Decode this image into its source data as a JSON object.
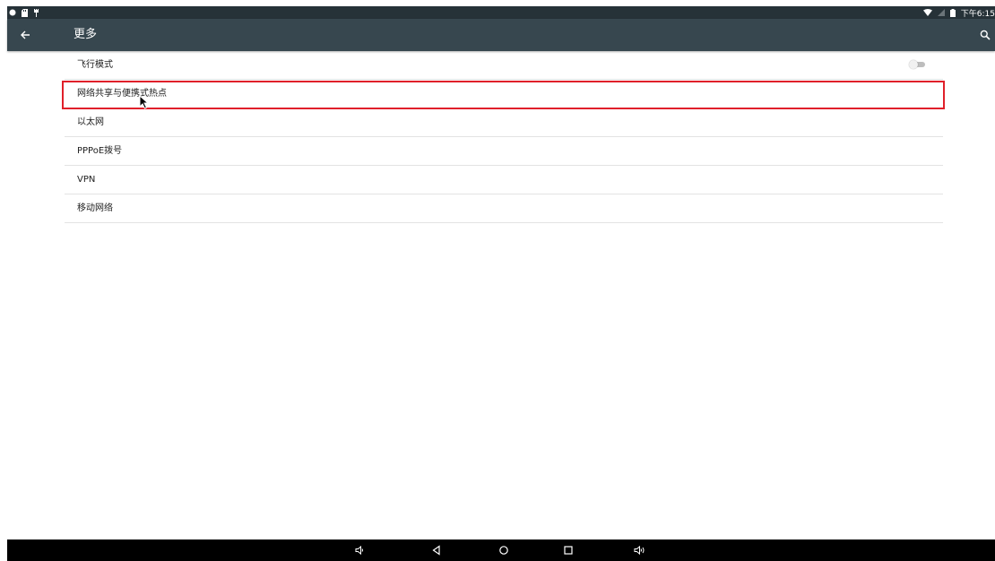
{
  "status_bar": {
    "time": "下午6:15",
    "left_icons": [
      "circle-notification-icon",
      "sd-card-icon",
      "usb-icon"
    ],
    "right_icons": [
      "wifi-icon",
      "signal-icon",
      "battery-icon"
    ]
  },
  "app_bar": {
    "title": "更多",
    "back_icon": "arrow-back-icon",
    "search_icon": "search-icon"
  },
  "settings": {
    "items": [
      {
        "label": "飞行模式",
        "toggle": false
      },
      {
        "label": "网络共享与便携式热点"
      },
      {
        "label": "以太网"
      },
      {
        "label": "PPPoE拨号"
      },
      {
        "label": "VPN"
      },
      {
        "label": "移动网络"
      }
    ]
  },
  "highlight": {
    "target": "网络共享与便携式热点",
    "color": "#e0202a"
  },
  "nav_bar": {
    "buttons": [
      "volume-down-icon",
      "back-icon",
      "home-icon",
      "recents-icon",
      "volume-up-icon"
    ]
  },
  "colors": {
    "status_bar": "#263238",
    "app_bar": "#37474f",
    "nav_bar": "#000000",
    "divider": "#e3e3e3"
  }
}
